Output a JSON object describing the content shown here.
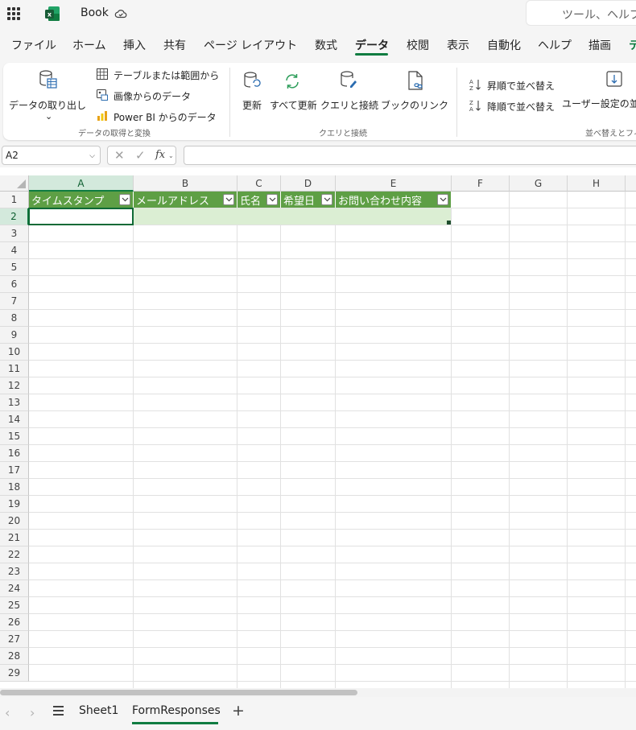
{
  "title_bar": {
    "app_icon": "excel-icon",
    "document_title": "Book",
    "sync_icon": "cloud-sync-icon",
    "search_text": "ツール、ヘルプ"
  },
  "menu": {
    "tabs": [
      {
        "label": "ファイル"
      },
      {
        "label": "ホーム"
      },
      {
        "label": "挿入"
      },
      {
        "label": "共有"
      },
      {
        "label": "ページ レイアウト"
      },
      {
        "label": "数式"
      },
      {
        "label": "データ",
        "active": true
      },
      {
        "label": "校閲"
      },
      {
        "label": "表示"
      },
      {
        "label": "自動化"
      },
      {
        "label": "ヘルプ"
      },
      {
        "label": "描画"
      },
      {
        "label": "テ"
      }
    ]
  },
  "ribbon": {
    "get_data": {
      "button_label": "データの取り出し",
      "chevron": "⌄",
      "from_table": "テーブルまたは範囲から",
      "from_image": "画像からのデータ",
      "from_powerbi": "Power BI からのデータ",
      "group_label": "データの取得と変換"
    },
    "queries": {
      "refresh": "更新",
      "refresh_all": "すべて更新",
      "queries_connections": "クエリと接続",
      "workbook_links": "ブックのリンク",
      "group_label": "クエリと接続"
    },
    "sort": {
      "sort_asc": "昇順で並べ替え",
      "sort_desc": "降順で並べ替え",
      "custom_sort": "ユーザー設定の並",
      "group_label": "並べ替えとフィ"
    }
  },
  "formula_bar": {
    "name_box": "A2",
    "cancel_glyph": "✕",
    "enter_glyph": "✓",
    "fx_label": "fx",
    "formula": ""
  },
  "grid": {
    "columns": [
      "A",
      "B",
      "C",
      "D",
      "E",
      "F",
      "G",
      "H"
    ],
    "rows": [
      "1",
      "2",
      "3",
      "4",
      "5",
      "6",
      "7",
      "8",
      "9",
      "10",
      "11",
      "12",
      "13",
      "14",
      "15",
      "16",
      "17",
      "18",
      "19",
      "20",
      "21",
      "22",
      "23",
      "24",
      "25",
      "26",
      "27",
      "28",
      "29"
    ],
    "selected_column": "A",
    "selected_row": "2",
    "table_headers": [
      "タイムスタンプ",
      "メールアドレス",
      "氏名",
      "希望日",
      "お問い合わせ内容"
    ],
    "accent_color": "#107c41",
    "table_header_color": "#5e9f45",
    "table_band_color": "#dbeed3"
  },
  "sheets": {
    "tabs": [
      {
        "label": "Sheet1"
      },
      {
        "label": "FormResponses",
        "active": true
      }
    ],
    "add_glyph": "+",
    "prev_glyph": "‹",
    "next_glyph": "›"
  }
}
